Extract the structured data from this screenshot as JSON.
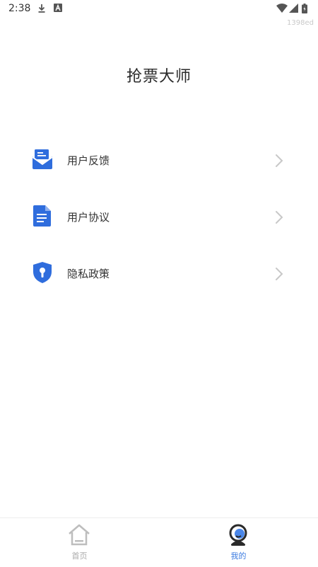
{
  "status_bar": {
    "time": "2:38",
    "build": "1398ed"
  },
  "app": {
    "title": "抢票大师"
  },
  "menu": [
    {
      "id": "feedback",
      "label": "用户反馈",
      "icon": "mail-icon"
    },
    {
      "id": "agreement",
      "label": "用户协议",
      "icon": "document-icon"
    },
    {
      "id": "privacy",
      "label": "隐私政策",
      "icon": "shield-icon"
    }
  ],
  "tabbar": [
    {
      "id": "home",
      "label": "首页",
      "icon": "home-icon",
      "active": false
    },
    {
      "id": "mine",
      "label": "我的",
      "icon": "profile-icon",
      "active": true
    }
  ],
  "colors": {
    "accent": "#3b7be0",
    "icon_blue": "#2f6ddd",
    "inactive": "#aaaaaa",
    "chevron": "#c8c8c8"
  }
}
